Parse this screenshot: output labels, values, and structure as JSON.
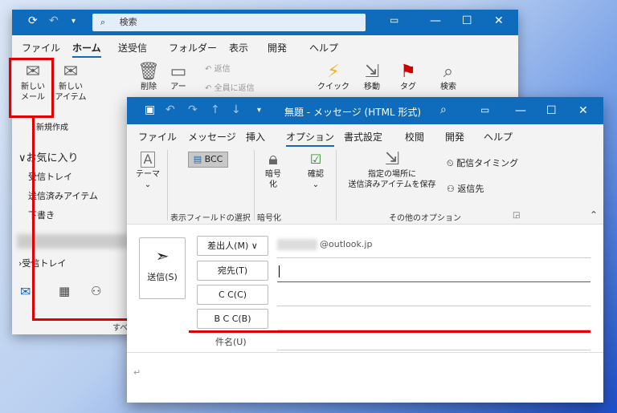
{
  "main_window": {
    "search_placeholder": "検索",
    "tabs": [
      "ファイル",
      "ホーム",
      "送受信",
      "フォルダー",
      "表示",
      "開発",
      "ヘルプ"
    ],
    "ribbon": {
      "new_mail": "新しい\nメール",
      "new_items": "新しい\nアイテム",
      "delete": "削除",
      "archive": "アー",
      "reply": "返信",
      "reply_all": "全員に返信",
      "quick_steps": "クイック",
      "move": "移動",
      "tags": "タグ",
      "find": "検索",
      "group_new": "新規作成"
    },
    "folders": {
      "favorites": "お気に入り",
      "inbox": "受信トレイ",
      "sent": "送信済みアイテム",
      "drafts": "下書き",
      "inbox2": "受信トレイ",
      "status": "すべて"
    }
  },
  "compose": {
    "title": "無題 - メッセージ (HTML 形式)",
    "tabs": [
      "ファイル",
      "メッセージ",
      "挿入",
      "オプション",
      "書式設定",
      "校閲",
      "開発",
      "ヘルプ"
    ],
    "active_tab": "オプション",
    "ribbon": {
      "theme": "テーマ",
      "bcc": "BCC",
      "encrypt": "暗号\n化",
      "permission": "確認",
      "save_sent": "指定の場所に\n送信済みアイテムを保存",
      "delay": "配信タイミング",
      "reply_to": "返信先",
      "group_show": "表示フィールドの選択",
      "group_encrypt": "暗号化",
      "group_more": "その他のオプション"
    },
    "send": "送信(S)",
    "from_label": "差出人(M)",
    "from_value": "@outlook.jp",
    "to_label": "宛先(T)",
    "cc_label": "C C(C)",
    "bcc_label": "B C C(B)",
    "subject_label": "件名(U)",
    "body_mark": "↵"
  },
  "colors": {
    "accent": "#0f6cbd",
    "highlight": "#e00000"
  }
}
